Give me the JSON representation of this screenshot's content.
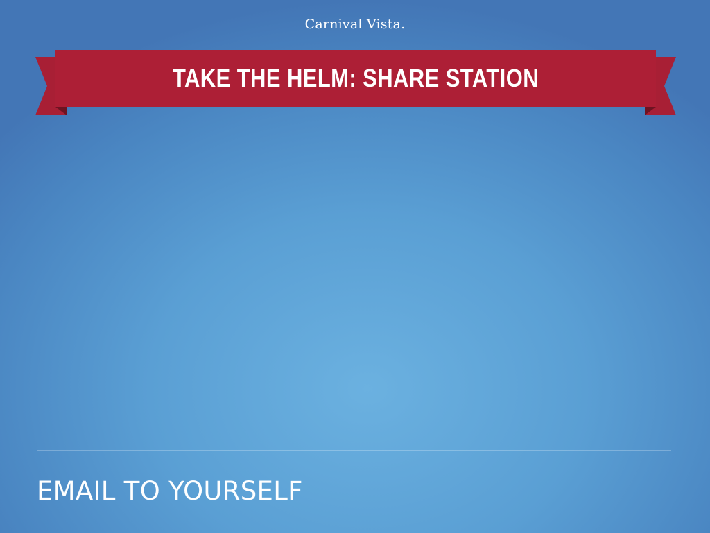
{
  "header": {
    "brand_logo_text": "Carnival Vista.",
    "banner_title": "TAKE THE HELM: SHARE STATION"
  },
  "options": {
    "email_to_yourself_label": "EMAIL TO YOURSELF"
  },
  "colors": {
    "banner_red": "#a81f35",
    "banner_dark_red": "#891a2b",
    "background_blue": "#5a9fd4"
  }
}
